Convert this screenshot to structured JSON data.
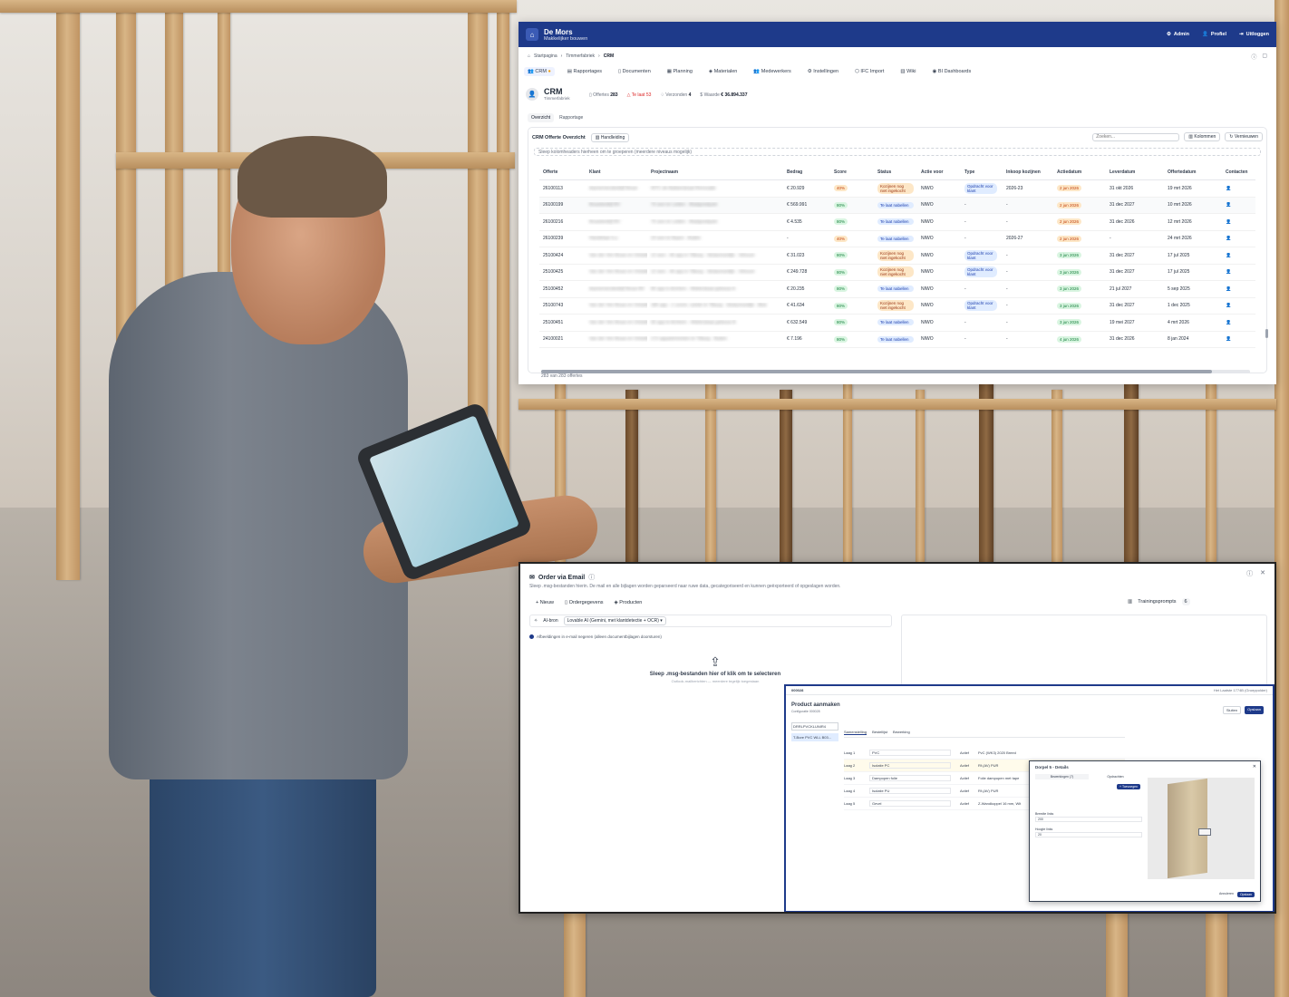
{
  "crm": {
    "brand": {
      "name": "De Mors",
      "tagline": "Makkelijker bouwen"
    },
    "topnav": [
      "Admin",
      "Profiel",
      "Uitloggen"
    ],
    "breadcrumb": [
      "Startpagina",
      "Timmerfabriek",
      "CRM"
    ],
    "modules": [
      "CRM",
      "Rapportages",
      "Documenten",
      "Planning",
      "Materialen",
      "Medewerkers",
      "Instellingen",
      "IFC Import",
      "Wiki",
      "BI Dashboards"
    ],
    "page_title": "CRM",
    "page_subtitle": "Timmerfabriek",
    "stats": [
      {
        "label": "Offertes",
        "value": "283"
      },
      {
        "label": "Te laat",
        "value": "53"
      },
      {
        "label": "Verzonden",
        "value": "4"
      },
      {
        "label": "Waarde",
        "value": "€ 36.894.337"
      }
    ],
    "subtabs": [
      "Overzicht",
      "Rapportage"
    ],
    "card_title": "CRM Offerte Overzicht",
    "manual_label": "Handleiding",
    "search_placeholder": "Zoeken...",
    "columns_btn": "Kolommen",
    "refresh_btn": "Vernieuwen",
    "group_hint": "Sleep kolomheaders hierheen om te groeperen (meerdere niveaus mogelijk)",
    "headers": [
      "Offerte",
      "Klant",
      "Projectnaam",
      "Bedrag",
      "Score",
      "Status",
      "Actie voor",
      "Type",
      "Inkoop kozijnen",
      "Actiedatum",
      "Leverdatum",
      "Offertedatum",
      "Contacten"
    ],
    "rows": [
      {
        "offerte": "26100113",
        "klant": "Aannemersbedrijf Bouw",
        "project": "WTC de Bakkerstraat Renovatie",
        "bedrag": "€ 20.929",
        "score": "40%",
        "status": "Kozijnen nog niet ingekocht",
        "actie": "NIWO",
        "type": "Opdracht voor klant",
        "inkoop": "2026-23",
        "actiedatum": "2 jun 2026",
        "leverdatum": "31 okt 2026",
        "offertedatum": "19 mrt 2026"
      },
      {
        "offerte": "26100199",
        "klant": "Bouwbedrijf BV",
        "project": "75 won te Leiden - Bladgoedpark",
        "bedrag": "€ 569.991",
        "score": "80%",
        "status": "Te laat nabellen",
        "actie": "NIWO",
        "type": "-",
        "inkoop": "-",
        "actiedatum": "2 jun 2026",
        "leverdatum": "31 dec 2027",
        "offertedatum": "10 mrt 2026"
      },
      {
        "offerte": "26100216",
        "klant": "Bouwbedrijf BV",
        "project": "75 won te Leiden - Bladgoedpark",
        "bedrag": "€ 4.535",
        "score": "80%",
        "status": "Te laat nabellen",
        "actie": "NIWO",
        "type": "-",
        "inkoop": "-",
        "actiedatum": "2 jun 2026",
        "leverdatum": "31 dec 2026",
        "offertedatum": "12 mrt 2026"
      },
      {
        "offerte": "26100239",
        "klant": "Handelaar b.v.",
        "project": "23 won te Baarn - Buiten",
        "bedrag": "-",
        "score": "40%",
        "status": "Te laat nabellen",
        "actie": "NIWO",
        "type": "-",
        "inkoop": "2026-27",
        "actiedatum": "2 jun 2026",
        "leverdatum": "-",
        "offertedatum": "24 mrt 2026"
      },
      {
        "offerte": "25100424",
        "klant": "Van der Ven Bouw en Ontwikkeling",
        "project": "12 won - 46 app in Tilburg - Stratumsedijk - Velouve",
        "bedrag": "€ 31.023",
        "score": "80%",
        "status": "Kozijnen nog niet ingekocht",
        "actie": "NIWO",
        "type": "Opdracht voor klant",
        "inkoop": "-",
        "actiedatum": "3 jun 2026",
        "leverdatum": "31 dec 2027",
        "offertedatum": "17 jul 2025"
      },
      {
        "offerte": "25100425",
        "klant": "Van der Ven Bouw en Ontwikkeling",
        "project": "12 won - 46 app in Tilburg - Stratumsedijk - Velouve",
        "bedrag": "€ 249.728",
        "score": "80%",
        "status": "Kozijnen nog niet ingekocht",
        "actie": "NIWO",
        "type": "Opdracht voor klant",
        "inkoop": "-",
        "actiedatum": "3 jun 2026",
        "leverdatum": "31 dec 2027",
        "offertedatum": "17 jul 2025"
      },
      {
        "offerte": "25100452",
        "klant": "Aannemersbedrijf Bouw BV",
        "project": "80 app in Arnhem - Wielersbaai gebouw A",
        "bedrag": "€ 20.235",
        "score": "80%",
        "status": "Te laat nabellen",
        "actie": "NIWO",
        "type": "-",
        "inkoop": "-",
        "actiedatum": "3 jun 2026",
        "leverdatum": "21 jul 2027",
        "offertedatum": "5 sep 2025"
      },
      {
        "offerte": "25100743",
        "klant": "Van der Ven Bouw en Ontwikkeling",
        "project": "186 app - 1 comm. ruimte te Tilburg - Stratumsedijk - Blok",
        "bedrag": "€ 41.634",
        "score": "80%",
        "status": "Kozijnen nog niet ingekocht",
        "actie": "NIWO",
        "type": "Opdracht voor klant",
        "inkoop": "-",
        "actiedatum": "3 jun 2026",
        "leverdatum": "31 dec 2027",
        "offertedatum": "1 dec 2025"
      },
      {
        "offerte": "25100451",
        "klant": "Van der Ven Bouw en Ontwikkeling",
        "project": "90 app te Arnhem - Wielersbaai gebouw B",
        "bedrag": "€ 632.549",
        "score": "80%",
        "status": "Te laat nabellen",
        "actie": "NIWO",
        "type": "-",
        "inkoop": "-",
        "actiedatum": "3 jun 2026",
        "leverdatum": "19 mei 2027",
        "offertedatum": "4 mrt 2026"
      },
      {
        "offerte": "24100021",
        "klant": "Van der Ven Bouw en Ontwikkeling",
        "project": "172 appartementen te Tilburg - Buiten",
        "bedrag": "€ 7.196",
        "score": "80%",
        "status": "Te laat nabellen",
        "actie": "NIWO",
        "type": "-",
        "inkoop": "-",
        "actiedatum": "4 jun 2026",
        "leverdatum": "31 dec 2026",
        "offertedatum": "8 jan 2024"
      }
    ],
    "row_count": "283 van 283 offertes"
  },
  "order": {
    "title": "Order via Email",
    "description": "Sleep .msg-bestanden hierin. De mail en alle bijlagen worden geparseerd naar ruwe data, gecategoriseerd en kunnen geëxporteerd of opgeslagen worden.",
    "actions": [
      "+ Nieuw",
      "Ordergegevens",
      "Producten"
    ],
    "training_label": "Trainingsprompts",
    "training_count": "6",
    "ai_label": "AI-bron",
    "ai_value": "Lovable AI (Gemini, met klantdetectie + OCR)",
    "checkbox_label": "Afbeeldingen in e-mail negeren (alleen documentbijlagen doorsturen)",
    "drop_title": "Sleep .msg-bestanden hier of klik om te selecteren",
    "drop_sub": "Outlook-mailberichten — meerdere tegelijk toegestaan"
  },
  "product": {
    "bar_left": "000028",
    "bar_right": "Het Laatste 1774B (Groeppolder)",
    "title": "Product aanmaken",
    "subtitle": "Configuratie 000028",
    "btn_close": "Sluiten",
    "btn_save": "Opslaan",
    "side_select": "DRRLPVCKLUNIR4",
    "side_item": "T-Bore PVC WLL B03...",
    "tabs": [
      "Samenstelling",
      "Bestellijst",
      "Bewerking"
    ],
    "layers": [
      {
        "name": "Laag 1",
        "material": "PVC",
        "status": "Actief",
        "value": "PvC (WK3) 2020 Breed"
      },
      {
        "name": "Laag 2",
        "material": "Isolatie PC",
        "status": "Actief",
        "value": "Rf.(AV) PUR"
      },
      {
        "name": "Laag 3",
        "material": "Dampopen folie",
        "status": "Actief",
        "value": "Folie dampopen met tape"
      },
      {
        "name": "Laag 4",
        "material": "Isolatie PU",
        "status": "Actief",
        "value": "Rf.(AV) PUR"
      },
      {
        "name": "Laag 5",
        "material": "Gevel",
        "status": "Actief",
        "value": "Z-Wandkoppel 16 mm, Wit"
      }
    ]
  },
  "detail": {
    "title": "Dorpel 5 - Details",
    "tabs": [
      "Bewerkingen (7)",
      "Opdrachten"
    ],
    "add_btn": "+ Toevoegen",
    "field1": "Breedte links",
    "field2": "Hoogte links",
    "val1": "200",
    "val2": "20",
    "footer_cancel": "Annuleren",
    "footer_save": "Opslaan"
  }
}
